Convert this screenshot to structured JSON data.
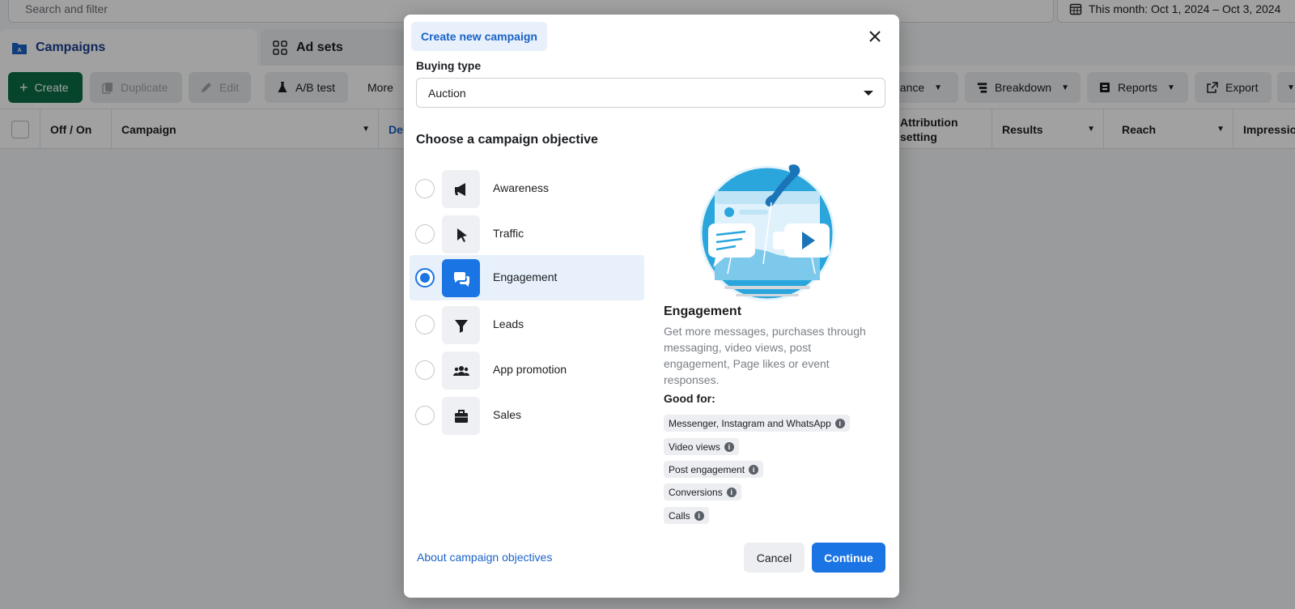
{
  "search": {
    "placeholder": "Search and filter"
  },
  "date_range": {
    "label": "This month: Oct 1, 2024 – Oct 3, 2024"
  },
  "tabs": [
    {
      "label": "Campaigns",
      "icon": "folder-icon"
    },
    {
      "label": "Ad sets",
      "icon": "grid-icon"
    }
  ],
  "toolbar": {
    "create": "Create",
    "duplicate": "Duplicate",
    "edit": "Edit",
    "ab_test": "A/B test",
    "more": "More",
    "performance": "nance",
    "breakdown": "Breakdown",
    "reports": "Reports",
    "export": "Export"
  },
  "table": {
    "columns": [
      "Off / On",
      "Campaign",
      "Deli",
      "Attribution setting",
      "Results",
      "Reach",
      "Impressio"
    ]
  },
  "modal": {
    "title": "Create new campaign",
    "buying_type_label": "Buying type",
    "buying_type_value": "Auction",
    "section_title": "Choose a campaign objective",
    "objectives": [
      {
        "label": "Awareness",
        "icon": "megaphone-icon",
        "selected": false
      },
      {
        "label": "Traffic",
        "icon": "cursor-icon",
        "selected": false
      },
      {
        "label": "Engagement",
        "icon": "chat-bubbles-icon",
        "selected": true
      },
      {
        "label": "Leads",
        "icon": "funnel-icon",
        "selected": false
      },
      {
        "label": "App promotion",
        "icon": "people-icon",
        "selected": false
      },
      {
        "label": "Sales",
        "icon": "briefcase-icon",
        "selected": false
      }
    ],
    "detail": {
      "title": "Engagement",
      "description": "Get more messages, purchases through messaging, video views, post engagement, Page likes or event responses.",
      "good_for_label": "Good for:",
      "good_for": [
        "Messenger, Instagram and WhatsApp",
        "Video views",
        "Post engagement",
        "Conversions",
        "Calls"
      ]
    },
    "about_link": "About campaign objectives",
    "cancel": "Cancel",
    "continue": "Continue"
  },
  "colors": {
    "accent": "#1b74e4",
    "create_green": "#0b6e47",
    "selected_bg": "#e7f0fb"
  }
}
